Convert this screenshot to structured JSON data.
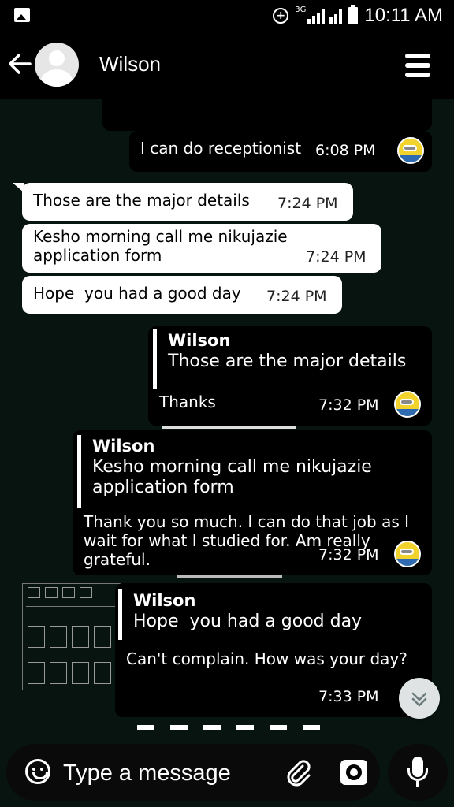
{
  "status_bar": {
    "time": "10:11 AM",
    "network": "3G",
    "icons": [
      "gallery-icon",
      "data-saver-icon",
      "signal-icon",
      "battery-icon"
    ]
  },
  "header": {
    "contact_name": "Wilson",
    "icons": [
      "back-arrow-icon",
      "avatar",
      "menu-icon"
    ]
  },
  "messages": [
    {
      "direction": "out",
      "text": "I can do receptionist",
      "time": "6:08 PM"
    },
    {
      "direction": "in",
      "text": "Those are the major details",
      "time": "7:24 PM"
    },
    {
      "direction": "in",
      "text": "Kesho morning call me nikujazie application form",
      "time": "7:24 PM"
    },
    {
      "direction": "in",
      "text": "Hope  you had a good day",
      "time": "7:24 PM"
    },
    {
      "direction": "out",
      "quote_name": "Wilson",
      "quote_text": "Those are the major details",
      "text": "Thanks",
      "time": "7:32 PM"
    },
    {
      "direction": "out",
      "quote_name": "Wilson",
      "quote_text": "Kesho morning call me nikujazie application form",
      "text": "Thank you so much. I can do that job as I wait for what I studied for. Am really grateful.",
      "time": "7:32 PM"
    },
    {
      "direction": "out",
      "quote_name": "Wilson",
      "quote_text": "Hope  you had a good day",
      "text": "Can't complain. How was your day?",
      "time": "7:33 PM"
    }
  ],
  "composer": {
    "placeholder": "Type a message",
    "icons": [
      "emoji-icon",
      "attach-icon",
      "camera-icon",
      "microphone-icon"
    ]
  },
  "colors": {
    "chat_background": "#071410",
    "incoming_bubble": "#ffffff",
    "outgoing_bubble": "#000000"
  }
}
